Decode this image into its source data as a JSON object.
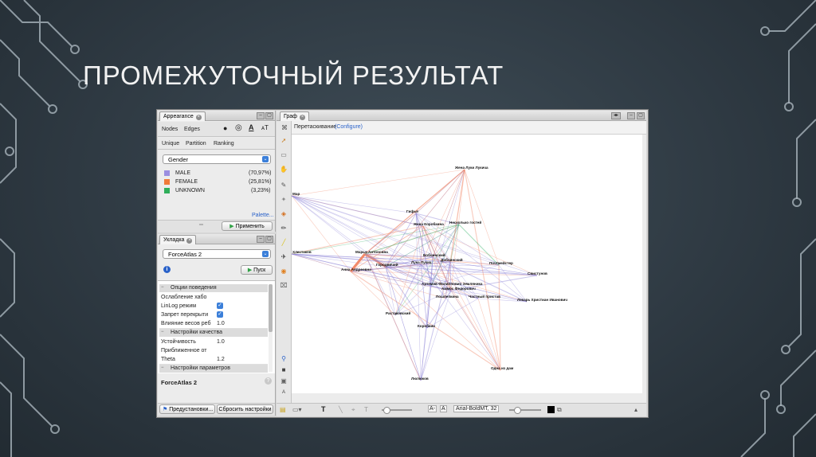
{
  "slide": {
    "title": "ПРОМЕЖУТОЧНЫЙ РЕЗУЛЬТАТ"
  },
  "appearance": {
    "tab_label": "Appearance",
    "subtabs": [
      "Nodes",
      "Edges"
    ],
    "modes": [
      "Unique",
      "Partition",
      "Ranking"
    ],
    "attribute": "Gender",
    "legend": [
      {
        "label": "MALE",
        "pct": "(70,97%)",
        "color": "#9b8ee0"
      },
      {
        "label": "FEMALE",
        "pct": "(25,81%)",
        "color": "#f07a3a"
      },
      {
        "label": "UNKNOWN",
        "pct": "(3,23%)",
        "color": "#2fae5a"
      }
    ],
    "palette_link": "Palette...",
    "apply_button": "Применить"
  },
  "layout": {
    "tab_label": "Укладка",
    "algorithm": "ForceAtlas 2",
    "run_button": "Пуск",
    "info_icon_glyph": "i",
    "groups": {
      "behavior": "Опции поведения",
      "quality": "Настройки качества",
      "params": "Настройки параметров"
    },
    "behavior_props": [
      {
        "name": "Ослабление хабо",
        "value": "",
        "checked": false
      },
      {
        "name": "LinLog режим",
        "value": "",
        "checked": true
      },
      {
        "name": "Запрет перекрыти",
        "value": "",
        "checked": true
      },
      {
        "name": "Влияние весов реб",
        "value": "1.0",
        "checked": false
      }
    ],
    "quality_props": [
      {
        "name": "Устойчивость",
        "value": "1.0"
      },
      {
        "name": "Приближенное от",
        "value": ""
      },
      {
        "name": "Theta",
        "value": "1.2"
      }
    ],
    "description_title": "ForceAtlas 2",
    "presets_button": "Предустановки...",
    "reset_button": "Сбросить настройки"
  },
  "graph": {
    "tab_label": "Граф",
    "mode_label": "Перетаскивание",
    "configure_link": "(Configure)",
    "font_label": "Arial-BoldMT, 32",
    "edge_colors": {
      "male": "#8e86d8",
      "female": "#f28a6a",
      "unknown": "#40b870"
    },
    "nodes": [
      {
        "label": "Жена Луки Лукича"
      },
      {
        "label": "Мар"
      },
      {
        "label": "Гифья"
      },
      {
        "label": "Жена Коробкина"
      },
      {
        "label": "Несколько гостей"
      },
      {
        "label": "Хлестаков"
      },
      {
        "label": "Марья Антоновна"
      },
      {
        "label": "Анна Андреевна"
      },
      {
        "label": "Городничий"
      },
      {
        "label": "Лука Лукич"
      },
      {
        "label": "Бобчинский"
      },
      {
        "label": "Добчинский"
      },
      {
        "label": "Почтмейстер"
      },
      {
        "label": "Свистунов"
      },
      {
        "label": "Артемий Филиппович Земляника"
      },
      {
        "label": "Аммос Федорович"
      },
      {
        "label": "Частный пристав"
      },
      {
        "label": "Пошлепкина"
      },
      {
        "label": "Лекарь Христиан Иванович"
      },
      {
        "label": "Растаковский"
      },
      {
        "label": "Коробкин"
      },
      {
        "label": "Одна из дам"
      },
      {
        "label": "Люлюков"
      }
    ]
  }
}
